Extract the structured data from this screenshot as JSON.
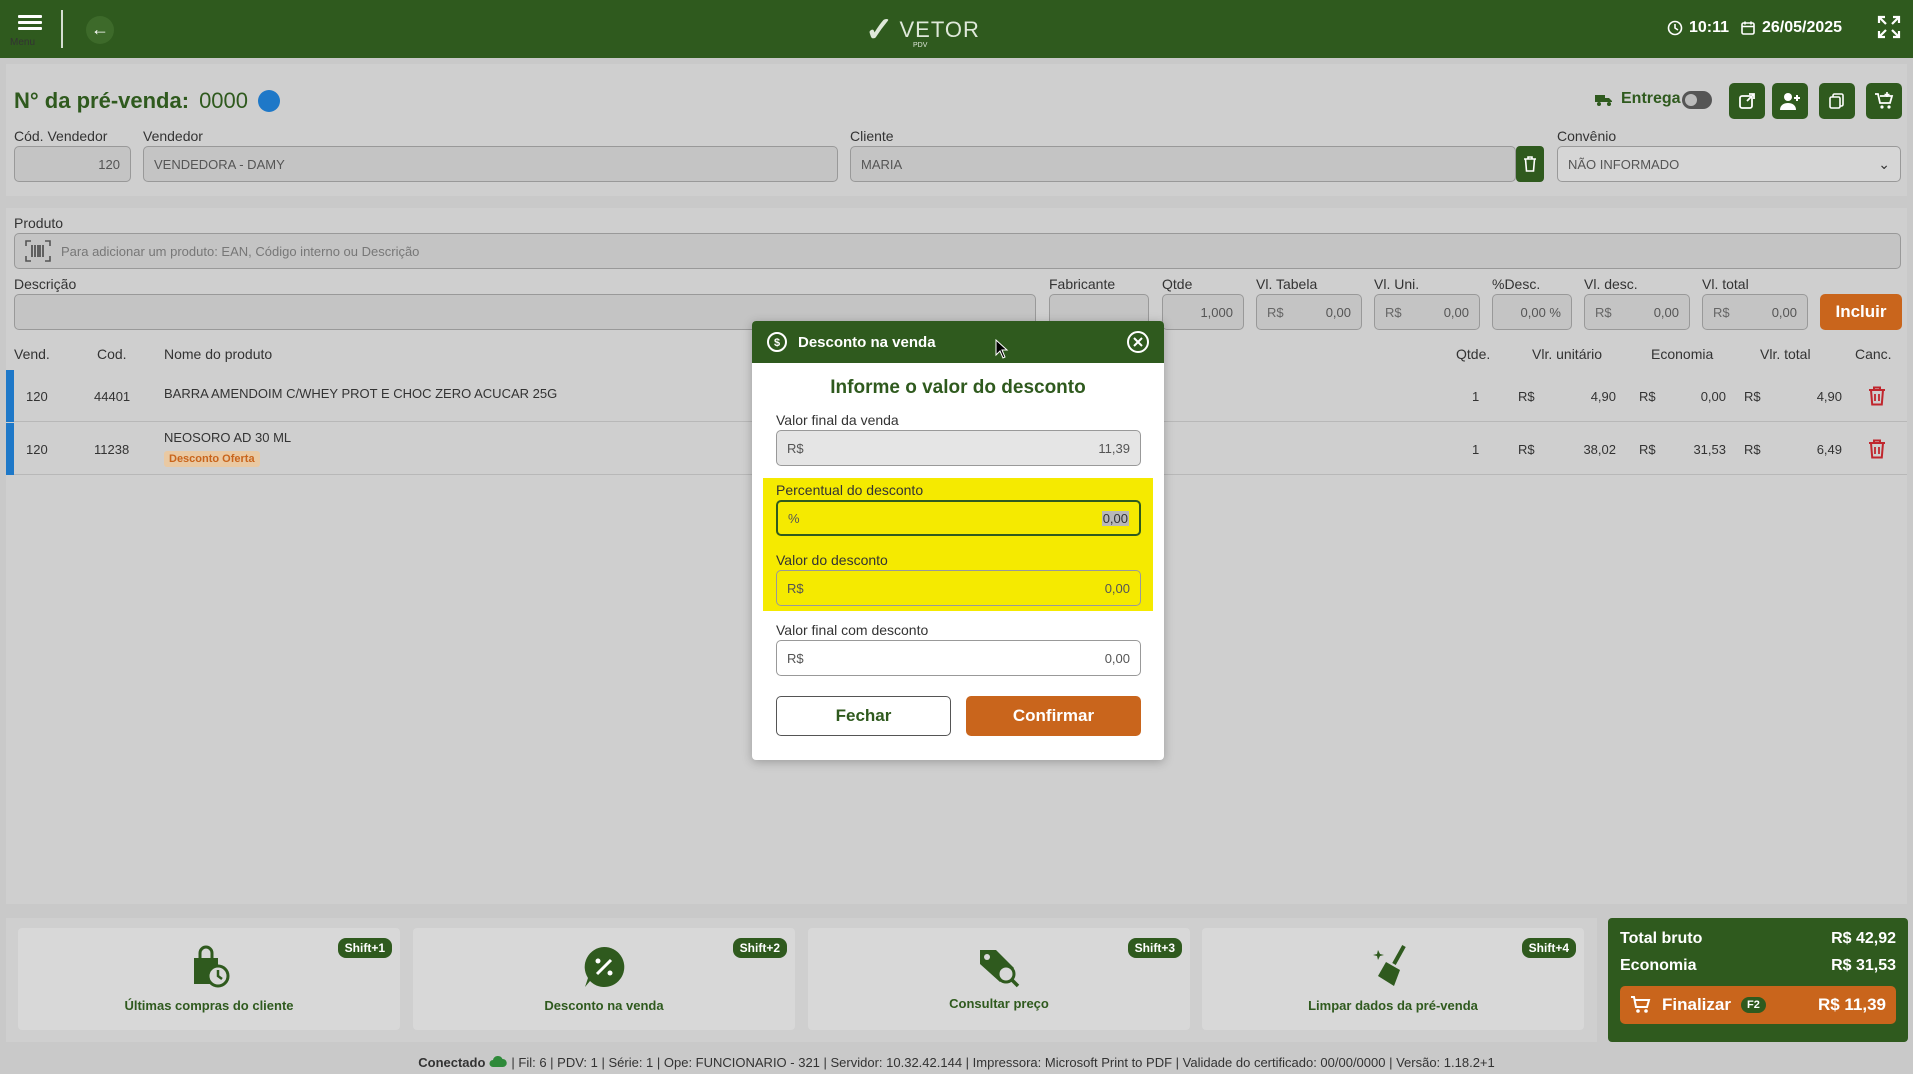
{
  "topbar": {
    "menu_label": "Menu",
    "logo_name": "VETOR",
    "logo_sub": "PDV",
    "time": "10:11",
    "date": "26/05/2025"
  },
  "header": {
    "title_prefix": "N° da pré-venda:",
    "title_number": "0000",
    "entrega_label": "Entrega"
  },
  "form": {
    "cod_vendedor_label": "Cód. Vendedor",
    "cod_vendedor_value": "120",
    "vendedor_label": "Vendedor",
    "vendedor_value": "VENDEDORA - DAMY",
    "cliente_label": "Cliente",
    "cliente_value": "MARIA",
    "convenio_label": "Convênio",
    "convenio_value": "NÃO INFORMADO",
    "produto_label": "Produto",
    "produto_placeholder": "Para adicionar um produto: EAN, Código interno ou Descrição",
    "descricao_label": "Descrição",
    "fabricante_label": "Fabricante",
    "qtde_label": "Qtde",
    "qtde_value": "1,000",
    "vl_tabela_label": "Vl. Tabela",
    "vl_uni_label": "Vl. Uni.",
    "pct_desc_label": "%Desc.",
    "pct_desc_value": "0,00 %",
    "vl_desc_label": "Vl. desc.",
    "vl_total_label": "Vl. total",
    "currency": "R$",
    "zero": "0,00",
    "incluir_label": "Incluir"
  },
  "table": {
    "headers": [
      "Vend.",
      "Cod.",
      "Nome do produto",
      "Qtde.",
      "Vlr. unitário",
      "Economia",
      "Vlr. total",
      "Canc."
    ],
    "rows": [
      {
        "vend": "120",
        "cod": "44401",
        "nome": "BARRA AMENDOIM C/WHEY PROT E CHOC ZERO ACUCAR 25G",
        "qtde": "1",
        "unit": "4,90",
        "economia": "0,00",
        "total": "4,90",
        "badge": ""
      },
      {
        "vend": "120",
        "cod": "11238",
        "nome": "NEOSORO AD 30 ML",
        "qtde": "1",
        "unit": "38,02",
        "economia": "31,53",
        "total": "6,49",
        "badge": "Desconto Oferta"
      }
    ]
  },
  "actions": [
    {
      "label": "Últimas compras do cliente",
      "shortcut": "Shift+1",
      "icon": "shopping-bag-clock-icon"
    },
    {
      "label": "Desconto na venda",
      "shortcut": "Shift+2",
      "icon": "discount-tag-icon"
    },
    {
      "label": "Consultar preço",
      "shortcut": "Shift+3",
      "icon": "price-search-icon"
    },
    {
      "label": "Limpar dados da pré-venda",
      "shortcut": "Shift+4",
      "icon": "broom-icon"
    }
  ],
  "totals": {
    "bruto_label": "Total bruto",
    "bruto_value": "R$ 42,92",
    "economia_label": "Economia",
    "economia_value": "R$ 31,53",
    "finalizar_label": "Finalizar",
    "finalizar_key": "F2",
    "finalizar_value": "R$ 11,39"
  },
  "status": {
    "left": "Conectado",
    "right": "| Fil: 6 | PDV: 1 | Série: 1 | Ope: FUNCIONARIO - 321 | Servidor: 10.32.42.144 | Impressora: Microsoft Print to PDF | Validade do certificado: 00/00/0000 | Versão: 1.18.2+1"
  },
  "modal": {
    "title": "Desconto na venda",
    "heading": "Informe o valor do desconto",
    "valor_final_label": "Valor final da venda",
    "valor_final_value": "11,39",
    "percentual_label": "Percentual do desconto",
    "percentual_prefix": "%",
    "percentual_value": "0,00",
    "valor_desconto_label": "Valor do desconto",
    "valor_desconto_value": "0,00",
    "valor_final_desc_label": "Valor final com desconto",
    "valor_final_desc_value": "0,00",
    "currency": "R$",
    "fechar_label": "Fechar",
    "confirmar_label": "Confirmar"
  },
  "colors": {
    "primary_green": "#2f5a1e",
    "accent_orange": "#c9651c",
    "highlight_yellow": "#f5ea00",
    "status_blue": "#1e78c8",
    "delete_red": "#c0262d"
  }
}
